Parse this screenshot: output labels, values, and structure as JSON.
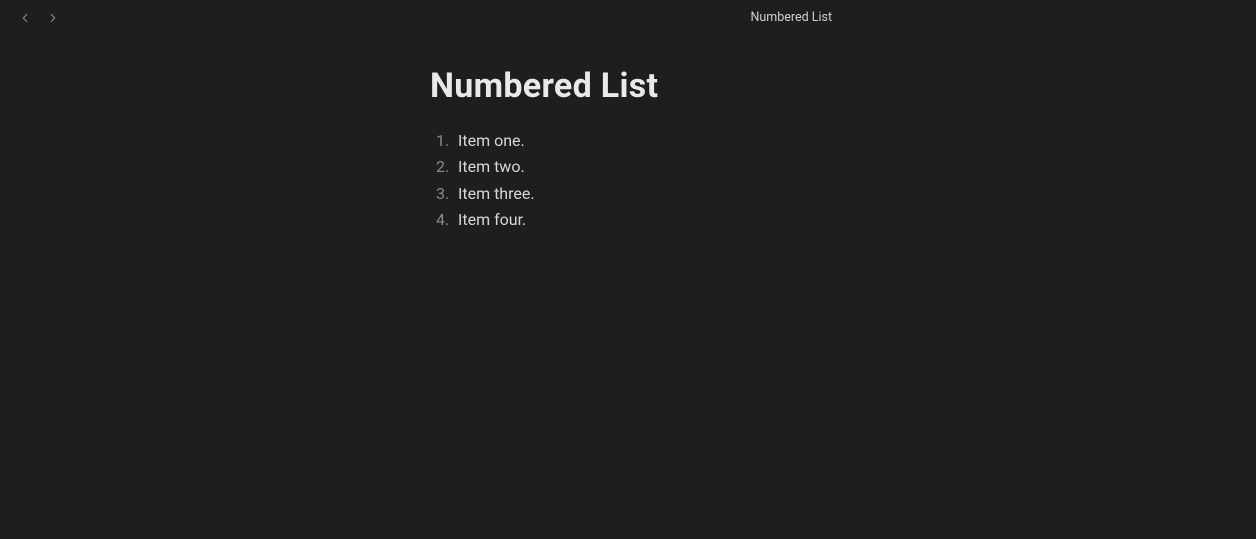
{
  "header": {
    "title": "Numbered List"
  },
  "document": {
    "heading": "Numbered List",
    "items": [
      "Item one.",
      "Item two.",
      "Item three.",
      "Item four."
    ]
  }
}
